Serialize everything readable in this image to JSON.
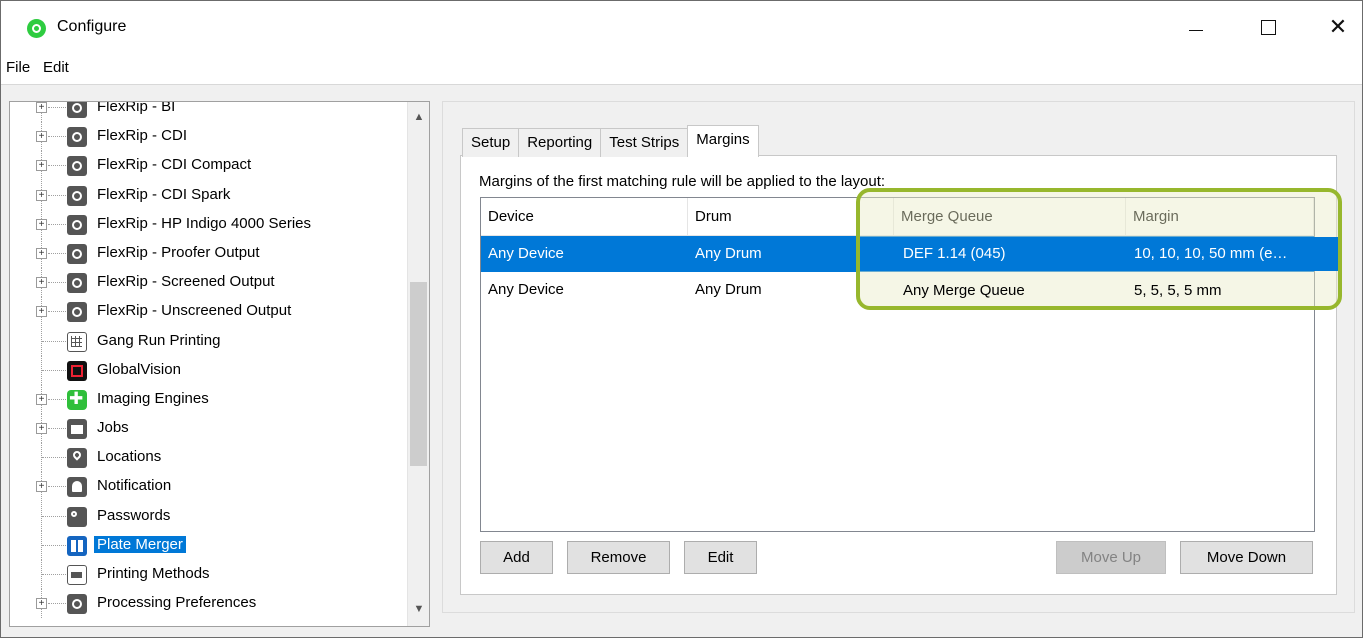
{
  "window": {
    "title": "Configure"
  },
  "menu": {
    "file": "File",
    "edit": "Edit"
  },
  "tree": {
    "items": [
      {
        "label": "FlexRip - BI",
        "icon": "gear-icon",
        "expandable": true
      },
      {
        "label": "FlexRip - CDI",
        "icon": "gear-icon",
        "expandable": true
      },
      {
        "label": "FlexRip - CDI Compact",
        "icon": "gear-icon",
        "expandable": true
      },
      {
        "label": "FlexRip - CDI Spark",
        "icon": "gear-icon",
        "expandable": true
      },
      {
        "label": "FlexRip - HP Indigo 4000 Series",
        "icon": "gear-icon",
        "expandable": true
      },
      {
        "label": "FlexRip - Proofer Output",
        "icon": "gear-icon",
        "expandable": true
      },
      {
        "label": "FlexRip - Screened Output",
        "icon": "gear-icon",
        "expandable": true
      },
      {
        "label": "FlexRip - Unscreened Output",
        "icon": "gear-icon",
        "expandable": true
      },
      {
        "label": "Gang Run Printing",
        "icon": "grid-icon",
        "expandable": false
      },
      {
        "label": "GlobalVision",
        "icon": "globalvision-icon",
        "expandable": false
      },
      {
        "label": "Imaging Engines",
        "icon": "imaging-engine-icon",
        "expandable": true
      },
      {
        "label": "Jobs",
        "icon": "folder-icon",
        "expandable": true
      },
      {
        "label": "Locations",
        "icon": "location-pin-icon",
        "expandable": false
      },
      {
        "label": "Notification",
        "icon": "bell-icon",
        "expandable": true
      },
      {
        "label": "Passwords",
        "icon": "key-icon",
        "expandable": false
      },
      {
        "label": "Plate Merger",
        "icon": "plate-merger-icon",
        "expandable": false,
        "selected": true
      },
      {
        "label": "Printing Methods",
        "icon": "printer-icon",
        "expandable": false
      },
      {
        "label": "Processing Preferences",
        "icon": "gear-icon",
        "expandable": true
      }
    ]
  },
  "tabs": [
    "Setup",
    "Reporting",
    "Test Strips",
    "Margins"
  ],
  "active_tab": "Margins",
  "margins": {
    "caption": "Margins of the first matching rule will be applied to the layout:",
    "columns": [
      "Device",
      "Drum",
      "Merge Queue",
      "Margin"
    ],
    "rows": [
      {
        "device": "Any Device",
        "drum": "Any Drum",
        "merge_queue": "DEF 1.14 (045)",
        "margin": "10, 10, 10, 50 mm (e…",
        "selected": true
      },
      {
        "device": "Any Device",
        "drum": "Any Drum",
        "merge_queue": "Any Merge Queue",
        "margin": "5, 5, 5, 5 mm",
        "selected": false
      }
    ]
  },
  "buttons": {
    "add": "Add",
    "remove": "Remove",
    "edit": "Edit",
    "move_up": "Move Up",
    "move_down": "Move Down"
  },
  "colors": {
    "selection": "#0078d7",
    "highlight_outline": "#97b72d",
    "app_icon": "#2ecc40"
  }
}
